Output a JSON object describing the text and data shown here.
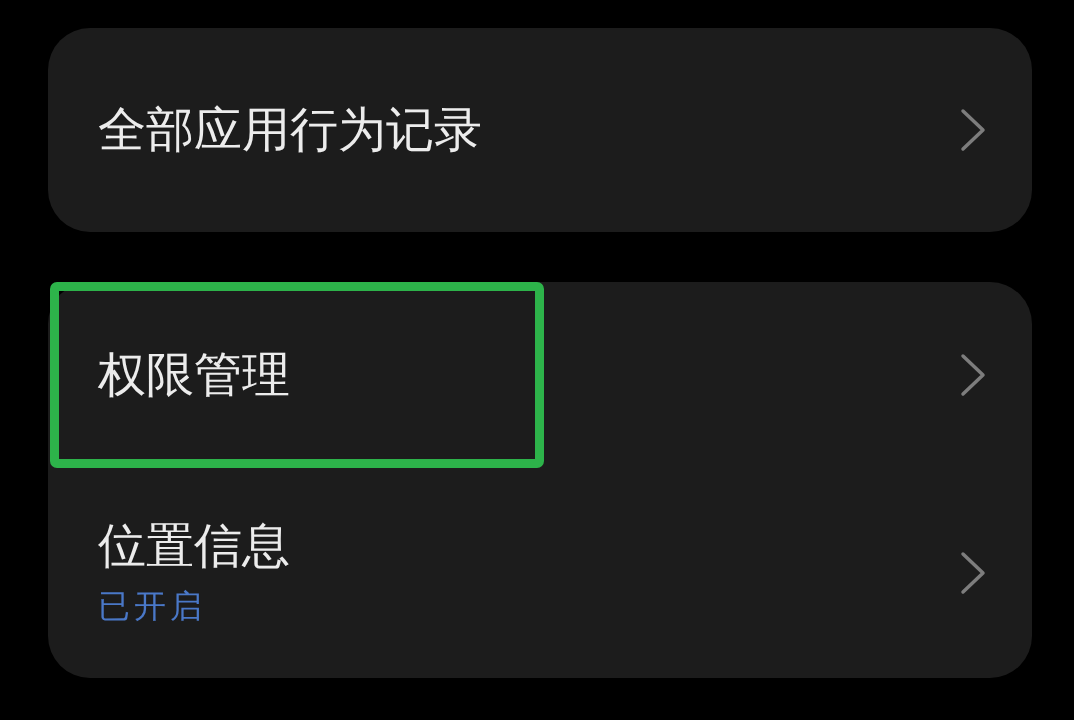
{
  "groups": [
    {
      "items": [
        {
          "title": "全部应用行为记录",
          "highlighted": false
        }
      ]
    },
    {
      "items": [
        {
          "title": "权限管理",
          "highlighted": true
        },
        {
          "title": "位置信息",
          "subtitle": "已开启",
          "highlighted": false
        }
      ]
    }
  ]
}
